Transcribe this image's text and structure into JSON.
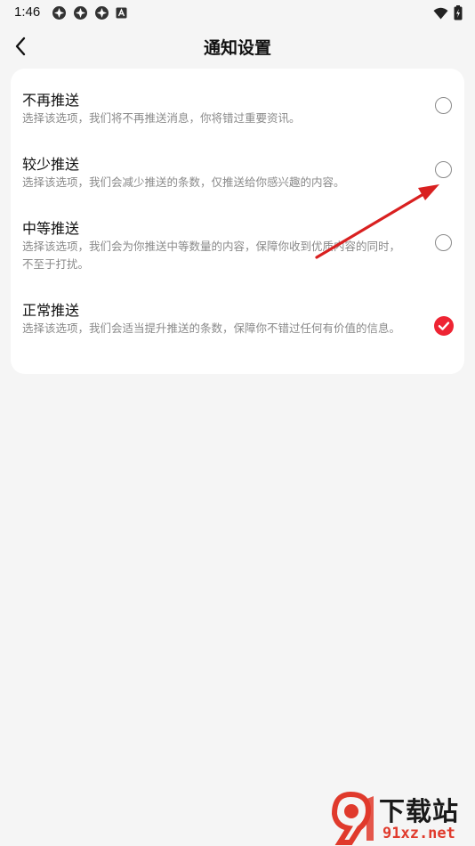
{
  "status_bar": {
    "time": "1:46"
  },
  "header": {
    "title": "通知设置"
  },
  "options": [
    {
      "title": "不再推送",
      "description": "选择该选项，我们将不再推送消息，你将错过重要资讯。",
      "selected": false
    },
    {
      "title": "较少推送",
      "description": "选择该选项，我们会减少推送的条数，仅推送给你感兴趣的内容。",
      "selected": false
    },
    {
      "title": "中等推送",
      "description": "选择该选项，我们会为你推送中等数量的内容，保障你收到优质内容的同时，不至于打扰。",
      "selected": false
    },
    {
      "title": "正常推送",
      "description": "选择该选项，我们会适当提升推送的条数，保障你不错过任何有价值的信息。",
      "selected": true
    }
  ],
  "colors": {
    "accent": "#ee2433",
    "annotation_arrow": "#e02020",
    "background": "#f5f5f5",
    "card": "#ffffff"
  },
  "watermark": {
    "main": "下载站",
    "sub": "91xz.net"
  }
}
